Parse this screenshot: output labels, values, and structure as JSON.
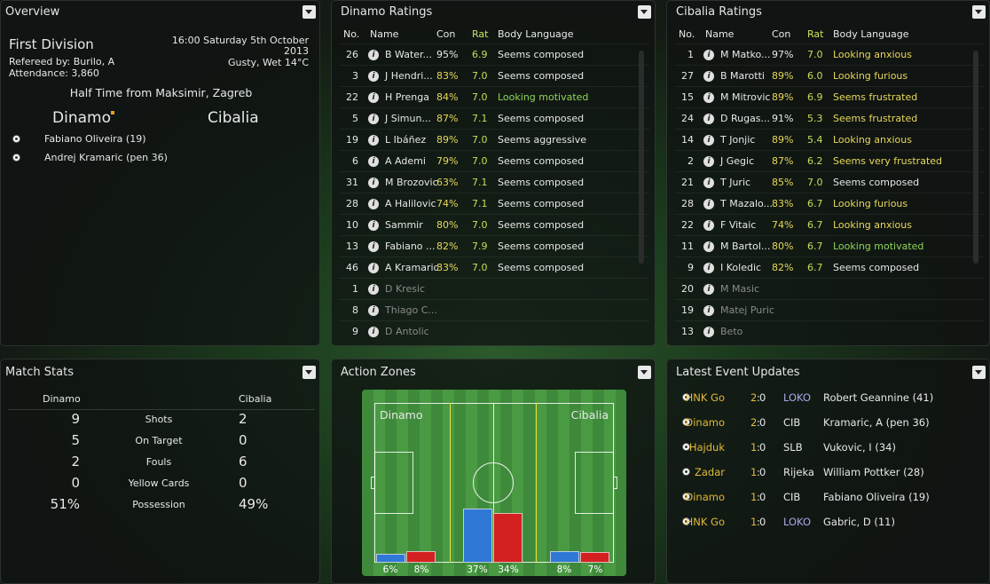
{
  "overview": {
    "title": "Overview",
    "competition": "First Division",
    "referee": "Refereed by: Burilo, A",
    "attendance": "Attendance: 3,860",
    "datetime_line1": "16:00 Saturday 5th October",
    "datetime_line2": "2013",
    "weather": "Gusty, Wet 14°C",
    "status": "Half Time from Maksimir, Zagreb",
    "home_team": "Dinamo",
    "away_team": "Cibalia",
    "goals": [
      "Fabiano Oliveira (19)",
      "Andrej Kramaric (pen 36)"
    ]
  },
  "dinamo_ratings": {
    "title": "Dinamo Ratings",
    "headers": {
      "no": "No.",
      "name": "Name",
      "con": "Con",
      "rat": "Rat",
      "bl": "Body Language"
    },
    "rows": [
      {
        "no": "26",
        "name": "B Water...",
        "con": "95%",
        "rat": "6.9",
        "bl": "Seems composed"
      },
      {
        "no": "3",
        "name": "J Hendri...",
        "con": "83%",
        "rat": "7.0",
        "bl": "Seems composed"
      },
      {
        "no": "22",
        "name": "H Prenga",
        "con": "84%",
        "rat": "7.0",
        "bl": "Looking motivated"
      },
      {
        "no": "5",
        "name": "J Simun...",
        "con": "87%",
        "rat": "7.1",
        "bl": "Seems composed"
      },
      {
        "no": "19",
        "name": "L Ibáñez",
        "con": "89%",
        "rat": "7.0",
        "bl": "Seems aggressive"
      },
      {
        "no": "6",
        "name": "A Ademi",
        "con": "79%",
        "rat": "7.0",
        "bl": "Seems composed"
      },
      {
        "no": "31",
        "name": "M Brozovic",
        "con": "63%",
        "rat": "7.1",
        "bl": "Seems composed"
      },
      {
        "no": "28",
        "name": "A Halilovic",
        "con": "74%",
        "rat": "7.1",
        "bl": "Seems composed"
      },
      {
        "no": "10",
        "name": "Sammir",
        "con": "80%",
        "rat": "7.0",
        "bl": "Seems composed"
      },
      {
        "no": "13",
        "name": "Fabiano ...",
        "con": "82%",
        "rat": "7.9",
        "bl": "Seems composed"
      },
      {
        "no": "46",
        "name": "A Kramaric",
        "con": "83%",
        "rat": "7.0",
        "bl": "Seems composed"
      },
      {
        "no": "1",
        "name": "D Kresic",
        "con": "",
        "rat": "",
        "bl": ""
      },
      {
        "no": "8",
        "name": "Thiago C...",
        "con": "",
        "rat": "",
        "bl": ""
      },
      {
        "no": "9",
        "name": "D Antolic",
        "con": "",
        "rat": "",
        "bl": ""
      }
    ]
  },
  "cibalia_ratings": {
    "title": "Cibalia Ratings",
    "headers": {
      "no": "No.",
      "name": "Name",
      "con": "Con",
      "rat": "Rat",
      "bl": "Body Language"
    },
    "rows": [
      {
        "no": "1",
        "name": "M Matko...",
        "con": "97%",
        "rat": "7.0",
        "bl": "Looking anxious"
      },
      {
        "no": "27",
        "name": "B Marotti",
        "con": "89%",
        "rat": "6.0",
        "bl": "Looking furious"
      },
      {
        "no": "15",
        "name": "M Mitrovic",
        "con": "89%",
        "rat": "6.9",
        "bl": "Seems frustrated"
      },
      {
        "no": "24",
        "name": "D Rugas...",
        "con": "91%",
        "rat": "5.3",
        "bl": "Seems frustrated"
      },
      {
        "no": "14",
        "name": "T Jonjic",
        "con": "89%",
        "rat": "5.4",
        "bl": "Looking anxious"
      },
      {
        "no": "2",
        "name": "J Gegic",
        "con": "87%",
        "rat": "6.2",
        "bl": "Seems very frustrated"
      },
      {
        "no": "21",
        "name": "T Juric",
        "con": "85%",
        "rat": "7.0",
        "bl": "Seems composed"
      },
      {
        "no": "28",
        "name": "T Mazalo...",
        "con": "83%",
        "rat": "6.7",
        "bl": "Looking furious"
      },
      {
        "no": "22",
        "name": "F Vitaic",
        "con": "74%",
        "rat": "6.7",
        "bl": "Looking anxious"
      },
      {
        "no": "11",
        "name": "M Bartol...",
        "con": "80%",
        "rat": "6.7",
        "bl": "Looking motivated"
      },
      {
        "no": "9",
        "name": "I Koledic",
        "con": "82%",
        "rat": "6.7",
        "bl": "Seems composed"
      },
      {
        "no": "20",
        "name": "M Masic",
        "con": "",
        "rat": "",
        "bl": ""
      },
      {
        "no": "19",
        "name": "Matej Puric",
        "con": "",
        "rat": "",
        "bl": ""
      },
      {
        "no": "13",
        "name": "Beto",
        "con": "",
        "rat": "",
        "bl": ""
      }
    ]
  },
  "match_stats": {
    "title": "Match Stats",
    "home": "Dinamo",
    "away": "Cibalia",
    "rows": [
      {
        "label": "Shots",
        "home": "9",
        "away": "2"
      },
      {
        "label": "On Target",
        "home": "5",
        "away": "0"
      },
      {
        "label": "Fouls",
        "home": "2",
        "away": "6"
      },
      {
        "label": "Yellow Cards",
        "home": "0",
        "away": "0"
      },
      {
        "label": "Possession",
        "home": "51%",
        "away": "49%"
      }
    ]
  },
  "action_zones": {
    "title": "Action Zones",
    "home": "Dinamo",
    "away": "Cibalia",
    "zones": [
      {
        "home": "6%",
        "away": "8%",
        "home_value": 6,
        "away_value": 8
      },
      {
        "home": "37%",
        "away": "34%",
        "home_value": 37,
        "away_value": 34
      },
      {
        "home": "8%",
        "away": "7%",
        "home_value": 8,
        "away_value": 7
      }
    ],
    "home_color": "#2f78d6",
    "away_color": "#d42020"
  },
  "events": {
    "title": "Latest Event Updates",
    "items": [
      {
        "home": "HNK Go",
        "hs": "2",
        "as": "0",
        "away": "LOKO",
        "desc": "Robert Geannine (41)"
      },
      {
        "home": "Dinamo",
        "hs": "2",
        "as": "0",
        "away": "CIB",
        "desc": "Kramaric, A (pen 36)"
      },
      {
        "home": "Hajduk",
        "hs": "1",
        "as": "0",
        "away": "SLB",
        "desc": "Vukovic, I (34)"
      },
      {
        "home": "Zadar",
        "hs": "1",
        "as": "0",
        "away": "Rijeka",
        "desc": "William Pottker (28)"
      },
      {
        "home": "Dinamo",
        "hs": "1",
        "as": "0",
        "away": "CIB",
        "desc": "Fabiano Oliveira (19)"
      },
      {
        "home": "HNK Go",
        "hs": "1",
        "as": "0",
        "away": "LOKO",
        "desc": "Gabric, D (11)"
      }
    ]
  }
}
